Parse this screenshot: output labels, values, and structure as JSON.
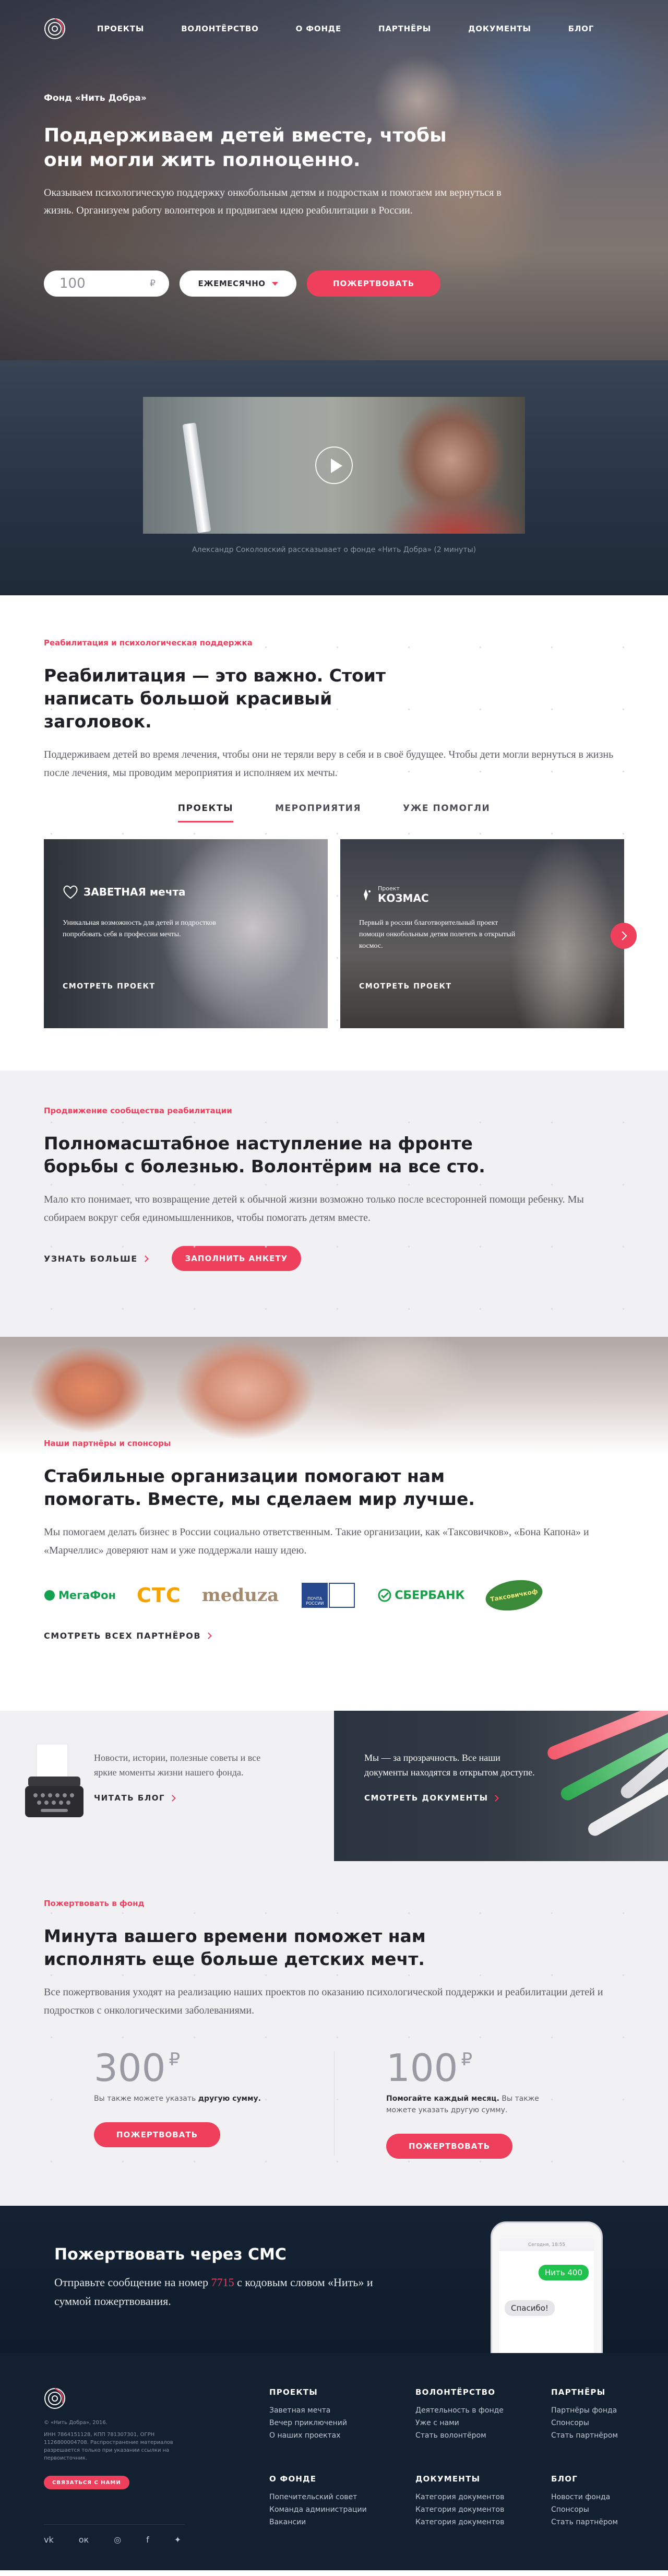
{
  "nav": {
    "items": [
      "ПРОЕКТЫ",
      "ВОЛОНТЁРСТВО",
      "О ФОНДЕ",
      "ПАРТНЁРЫ",
      "ДОКУМЕНТЫ",
      "БЛОГ"
    ]
  },
  "hero": {
    "fund_name": "Фонд «Нить Добра»",
    "title": "Поддерживаем детей вместе, чтобы они могли жить полноценно.",
    "text": "Оказываем психологическую поддержку онкобольным детям и подросткам и помогаем им вернуться в жизнь. Организуем работу волонтеров и продвигаем идею реабилитации в России.",
    "amount_value": "100",
    "currency": "₽",
    "period": "ЕЖЕМЕСЯЧНО",
    "donate_button": "ПОЖЕРТВОВАТЬ"
  },
  "video": {
    "caption": "Александр Соколовский рассказывает о фонде «Нить Добра» (2 минуты)"
  },
  "rehab": {
    "kicker": "Реабилитация и психологическая поддержка",
    "title": "Реабилитация — это важно. Стоит написать большой красивый заголовок.",
    "text": "Поддерживаем детей во время лечения, чтобы они не теряли веру в себя и в своё буду­щее. Чтобы дети могли вернуться в жизнь после лечения, мы проводим мероприятия и исполняем их мечты.",
    "tabs": [
      "ПРОЕКТЫ",
      "МЕРОПРИЯТИЯ",
      "УЖЕ ПОМОГЛИ"
    ],
    "cards": [
      {
        "logo": "ЗАВЕТНАЯ мечта",
        "desc": "Уникальная возможность для детей и подростков попробовать себя в профессии мечты.",
        "more": "СМОТРЕТЬ ПРОЕКТ"
      },
      {
        "logo_sub": "Проект",
        "logo": "КОЗМАС",
        "desc": "Первый в россии благотворительный проект помощи онкобольным детям полететь в открытый космос.",
        "more": "СМОТРЕТЬ ПРОЕКТ"
      }
    ]
  },
  "community": {
    "kicker": "Продвижение сообщества реабилитации",
    "title": "Полномасштабное наступление на фронте борьбы с болезнью. Волонтёрим на все сто.",
    "text": "Мало кто понимает, что возвращение детей к обычной жизни возможно только после всесторонней помощи ребенку. Мы собираем вокруг себя единомышленников, чтобы по­могать детям вместе.",
    "more": "УЗНАТЬ БОЛЬШЕ",
    "button": "ЗАПОЛНИТЬ АНКЕТУ"
  },
  "partners": {
    "kicker": "Наши партнёры и спонсоры",
    "title": "Стабильные организации помогают нам помогать. Вместе, мы сделаем мир лучше.",
    "text": "Мы помогаем делать бизнес в России социально ответственным. Такие организации, как «Таксовичков», «Бона Капона» и «Марчеллис» доверяют нам и уже поддержали нашу идею.",
    "logos": [
      "МегаФон",
      "СТС",
      "meduza",
      "ПОЧТА РОССИИ",
      "СБЕРБАНК",
      "Таксовичкоф"
    ],
    "more": "СМОТРЕТЬ ВСЕХ ПАРТНЁРОВ"
  },
  "blog": {
    "text": "Новости, истории, полезные советы и все яркие моменты жизни нашего фонда.",
    "more": "ЧИТАТЬ БЛОГ"
  },
  "docs": {
    "text": "Мы — за прозрачность. Все наши документы находятся в открытом доступе.",
    "more": "СМОТРЕТЬ ДОКУМЕНТЫ"
  },
  "donate": {
    "kicker": "Пожертвовать в фонд",
    "title": "Минута вашего времени поможет нам исполнять еще больше детских мечт.",
    "text": "Все пожертвования уходят на реализацию наших проектов по оказанию психологиче­ской поддержки и реабилитации детей и подростков с онкологическими заболеваниями.",
    "option1": {
      "value": "300",
      "currency": "₽",
      "note": "Вы также можете указать",
      "note_bold": "другую сумму.",
      "button": "ПОЖЕРТВОВАТЬ"
    },
    "option2": {
      "value": "100",
      "currency": "₽",
      "note_bold": "Помогайте каждый месяц.",
      "note": "Вы также можете указать другую сумму.",
      "button": "ПОЖЕРТВОВАТЬ"
    }
  },
  "sms": {
    "title": "Пожертвовать через СМС",
    "text_1": "Отправьте сообщение на номер",
    "number": "7715",
    "text_2": "с кодовым словом «Нить» и суммой пожертвования.",
    "phone_time": "Сегодня, 18:55",
    "msg_out": "Нить 400",
    "msg_in": "Спасибо!"
  },
  "footer": {
    "copyright": "© «Нить Добра», 2016.",
    "legal": "ИНН 7864151128, КПП 781307301, ОГРН 1126800004708. Распространение материалов разрешается только при указании ссылки на первоисточник.",
    "contact_button": "СВЯЗАТЬСЯ С НАМИ",
    "social": [
      "vk",
      "ok",
      "instagram",
      "facebook",
      "twitter"
    ],
    "cols": [
      {
        "title": "ПРОЕКТЫ",
        "links": [
          "Заветная мечта",
          "Вечер приключений",
          "О наших проектах"
        ]
      },
      {
        "title": "ВОЛОНТЁРСТВО",
        "links": [
          "Деятельность в фонде",
          "Уже с нами",
          "Стать волонтёром"
        ]
      },
      {
        "title": "ПАРТНЁРЫ",
        "links": [
          "Партнёры фонда",
          "Спонсоры",
          "Стать партнёром"
        ]
      },
      {
        "title": "О ФОНДЕ",
        "links": [
          "Попечительский совет",
          "Команда администрации",
          "Вакансии"
        ]
      },
      {
        "title": "ДОКУМЕНТЫ",
        "links": [
          "Категория документов",
          "Категория документов",
          "Категория документов"
        ]
      },
      {
        "title": "БЛОГ",
        "links": [
          "Новости фонда",
          "Спонсоры",
          "Стать партнёром"
        ]
      }
    ]
  },
  "colors": {
    "accent": "#ee3f5d",
    "dark": "#132030",
    "light_bg": "#f1f1f3"
  }
}
